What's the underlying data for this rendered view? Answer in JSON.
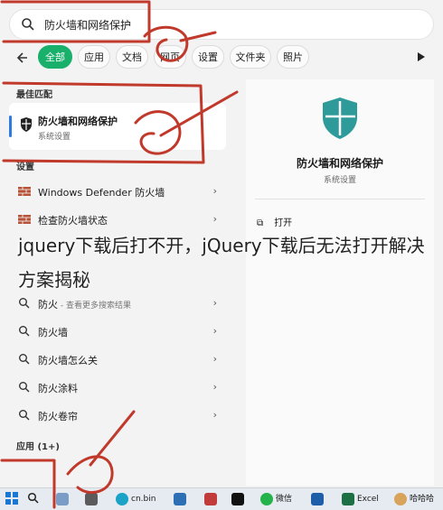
{
  "search": {
    "value": "防火墙和网络保护"
  },
  "tabs": [
    {
      "label": "全部",
      "active": true
    },
    {
      "label": "应用",
      "active": false
    },
    {
      "label": "文档",
      "active": false
    },
    {
      "label": "网页",
      "active": false
    },
    {
      "label": "设置",
      "active": false
    },
    {
      "label": "文件夹",
      "active": false
    },
    {
      "label": "照片",
      "active": false
    }
  ],
  "best_match": {
    "heading": "最佳匹配",
    "title": "防火墙和网络保护",
    "subtitle": "系统设置"
  },
  "settings": {
    "heading": "设置",
    "items": [
      {
        "label": "Windows Defender 防火墙"
      },
      {
        "label": "检查防火墙状态"
      }
    ]
  },
  "web": {
    "items": [
      {
        "label": "防火",
        "suffix": " - 查看更多搜索结果"
      },
      {
        "label": "防火墙"
      },
      {
        "label": "防火墙怎么关"
      },
      {
        "label": "防火涂料"
      },
      {
        "label": "防火卷帘"
      }
    ]
  },
  "apps": {
    "heading": "应用 (1+)"
  },
  "detail": {
    "title": "防火墙和网络保护",
    "subtitle": "系统设置",
    "open_label": "打开"
  },
  "overlay_text": "jquery下载后打不开，jQuery下载后无法打开解决方案揭秘",
  "taskbar": {
    "items": [
      {
        "label": "cn.bin"
      },
      {
        "label": "微信"
      },
      {
        "label": "Excel"
      },
      {
        "label": "哈哈哈"
      }
    ]
  },
  "colors": {
    "accent": "#18b06b",
    "shield": "#2e9a9a",
    "annotation": "#c0392b"
  }
}
